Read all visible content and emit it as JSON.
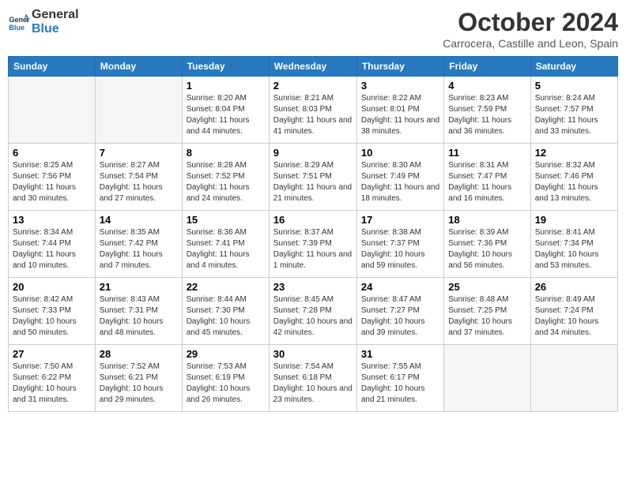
{
  "header": {
    "logo_line1": "General",
    "logo_line2": "Blue",
    "month_year": "October 2024",
    "location": "Carrocera, Castille and Leon, Spain"
  },
  "weekdays": [
    "Sunday",
    "Monday",
    "Tuesday",
    "Wednesday",
    "Thursday",
    "Friday",
    "Saturday"
  ],
  "weeks": [
    [
      {
        "day": "",
        "info": ""
      },
      {
        "day": "",
        "info": ""
      },
      {
        "day": "1",
        "info": "Sunrise: 8:20 AM\nSunset: 8:04 PM\nDaylight: 11 hours and 44 minutes."
      },
      {
        "day": "2",
        "info": "Sunrise: 8:21 AM\nSunset: 8:03 PM\nDaylight: 11 hours and 41 minutes."
      },
      {
        "day": "3",
        "info": "Sunrise: 8:22 AM\nSunset: 8:01 PM\nDaylight: 11 hours and 38 minutes."
      },
      {
        "day": "4",
        "info": "Sunrise: 8:23 AM\nSunset: 7:59 PM\nDaylight: 11 hours and 36 minutes."
      },
      {
        "day": "5",
        "info": "Sunrise: 8:24 AM\nSunset: 7:57 PM\nDaylight: 11 hours and 33 minutes."
      }
    ],
    [
      {
        "day": "6",
        "info": "Sunrise: 8:25 AM\nSunset: 7:56 PM\nDaylight: 11 hours and 30 minutes."
      },
      {
        "day": "7",
        "info": "Sunrise: 8:27 AM\nSunset: 7:54 PM\nDaylight: 11 hours and 27 minutes."
      },
      {
        "day": "8",
        "info": "Sunrise: 8:28 AM\nSunset: 7:52 PM\nDaylight: 11 hours and 24 minutes."
      },
      {
        "day": "9",
        "info": "Sunrise: 8:29 AM\nSunset: 7:51 PM\nDaylight: 11 hours and 21 minutes."
      },
      {
        "day": "10",
        "info": "Sunrise: 8:30 AM\nSunset: 7:49 PM\nDaylight: 11 hours and 18 minutes."
      },
      {
        "day": "11",
        "info": "Sunrise: 8:31 AM\nSunset: 7:47 PM\nDaylight: 11 hours and 16 minutes."
      },
      {
        "day": "12",
        "info": "Sunrise: 8:32 AM\nSunset: 7:46 PM\nDaylight: 11 hours and 13 minutes."
      }
    ],
    [
      {
        "day": "13",
        "info": "Sunrise: 8:34 AM\nSunset: 7:44 PM\nDaylight: 11 hours and 10 minutes."
      },
      {
        "day": "14",
        "info": "Sunrise: 8:35 AM\nSunset: 7:42 PM\nDaylight: 11 hours and 7 minutes."
      },
      {
        "day": "15",
        "info": "Sunrise: 8:36 AM\nSunset: 7:41 PM\nDaylight: 11 hours and 4 minutes."
      },
      {
        "day": "16",
        "info": "Sunrise: 8:37 AM\nSunset: 7:39 PM\nDaylight: 11 hours and 1 minute."
      },
      {
        "day": "17",
        "info": "Sunrise: 8:38 AM\nSunset: 7:37 PM\nDaylight: 10 hours and 59 minutes."
      },
      {
        "day": "18",
        "info": "Sunrise: 8:39 AM\nSunset: 7:36 PM\nDaylight: 10 hours and 56 minutes."
      },
      {
        "day": "19",
        "info": "Sunrise: 8:41 AM\nSunset: 7:34 PM\nDaylight: 10 hours and 53 minutes."
      }
    ],
    [
      {
        "day": "20",
        "info": "Sunrise: 8:42 AM\nSunset: 7:33 PM\nDaylight: 10 hours and 50 minutes."
      },
      {
        "day": "21",
        "info": "Sunrise: 8:43 AM\nSunset: 7:31 PM\nDaylight: 10 hours and 48 minutes."
      },
      {
        "day": "22",
        "info": "Sunrise: 8:44 AM\nSunset: 7:30 PM\nDaylight: 10 hours and 45 minutes."
      },
      {
        "day": "23",
        "info": "Sunrise: 8:45 AM\nSunset: 7:28 PM\nDaylight: 10 hours and 42 minutes."
      },
      {
        "day": "24",
        "info": "Sunrise: 8:47 AM\nSunset: 7:27 PM\nDaylight: 10 hours and 39 minutes."
      },
      {
        "day": "25",
        "info": "Sunrise: 8:48 AM\nSunset: 7:25 PM\nDaylight: 10 hours and 37 minutes."
      },
      {
        "day": "26",
        "info": "Sunrise: 8:49 AM\nSunset: 7:24 PM\nDaylight: 10 hours and 34 minutes."
      }
    ],
    [
      {
        "day": "27",
        "info": "Sunrise: 7:50 AM\nSunset: 6:22 PM\nDaylight: 10 hours and 31 minutes."
      },
      {
        "day": "28",
        "info": "Sunrise: 7:52 AM\nSunset: 6:21 PM\nDaylight: 10 hours and 29 minutes."
      },
      {
        "day": "29",
        "info": "Sunrise: 7:53 AM\nSunset: 6:19 PM\nDaylight: 10 hours and 26 minutes."
      },
      {
        "day": "30",
        "info": "Sunrise: 7:54 AM\nSunset: 6:18 PM\nDaylight: 10 hours and 23 minutes."
      },
      {
        "day": "31",
        "info": "Sunrise: 7:55 AM\nSunset: 6:17 PM\nDaylight: 10 hours and 21 minutes."
      },
      {
        "day": "",
        "info": ""
      },
      {
        "day": "",
        "info": ""
      }
    ]
  ]
}
